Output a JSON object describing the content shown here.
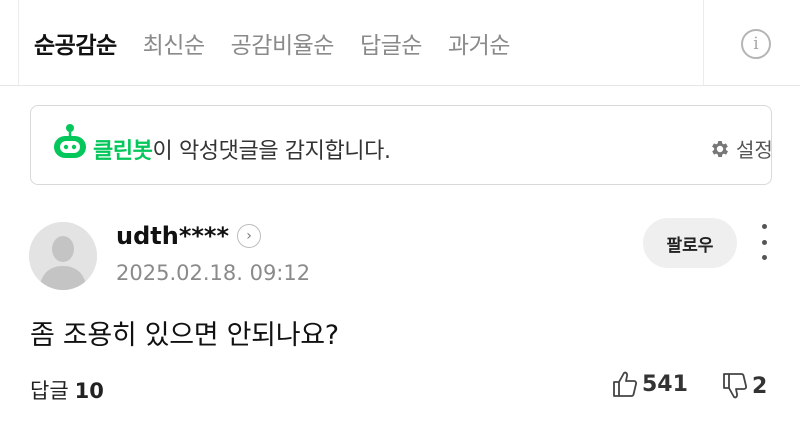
{
  "sort_tabs": [
    {
      "label": "순공감순",
      "active": true
    },
    {
      "label": "최신순",
      "active": false
    },
    {
      "label": "공감비율순",
      "active": false
    },
    {
      "label": "답글순",
      "active": false
    },
    {
      "label": "과거순",
      "active": false
    }
  ],
  "info_icon": {
    "glyph": "i",
    "icon": "info-icon"
  },
  "cleanbot": {
    "brand": "클린봇",
    "message": "이 악성댓글을 감지합니다.",
    "settings_label": "설정",
    "brand_color": "#03c75a"
  },
  "comment": {
    "username": "udth****",
    "arrow_glyph": "›",
    "timestamp": "2025.02.18. 09:12",
    "follow_label": "팔로우",
    "text": "좀 조용히 있으면 안되나요?",
    "reply_label": "답글",
    "reply_count": "10",
    "like_count": "541",
    "dislike_count": "2"
  }
}
